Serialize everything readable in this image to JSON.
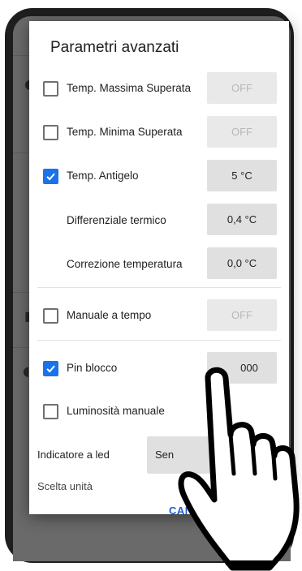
{
  "dialog": {
    "title": "Parametri avanzati",
    "rows": [
      {
        "label": "Temp. Massima Superata",
        "checked": false,
        "value": "OFF",
        "value_enabled": false
      },
      {
        "label": "Temp. Minima Superata",
        "checked": false,
        "value": "OFF",
        "value_enabled": false
      },
      {
        "label": "Temp. Antigelo",
        "checked": true,
        "value": "5 °C",
        "value_enabled": true
      },
      {
        "label": "Differenziale termico",
        "value": "0,4 °C",
        "value_enabled": true
      },
      {
        "label": "Correzione temperatura",
        "value": "0,0 °C",
        "value_enabled": true
      },
      {
        "label": "Manuale a tempo",
        "checked": false,
        "value": "OFF",
        "value_enabled": false
      },
      {
        "label": "Pin blocco",
        "checked": true,
        "value": "000",
        "value_enabled": true
      },
      {
        "label": "Luminosità manuale",
        "checked": false
      }
    ],
    "led": {
      "label": "Indicatore a led",
      "value": "Sen"
    },
    "partial_label": "Scelta unità",
    "action": "CAN"
  },
  "colors": {
    "accent": "#1a73e8",
    "action": "#1a5fd0"
  },
  "icons": [
    "check-icon",
    "hand-pointer-icon"
  ]
}
